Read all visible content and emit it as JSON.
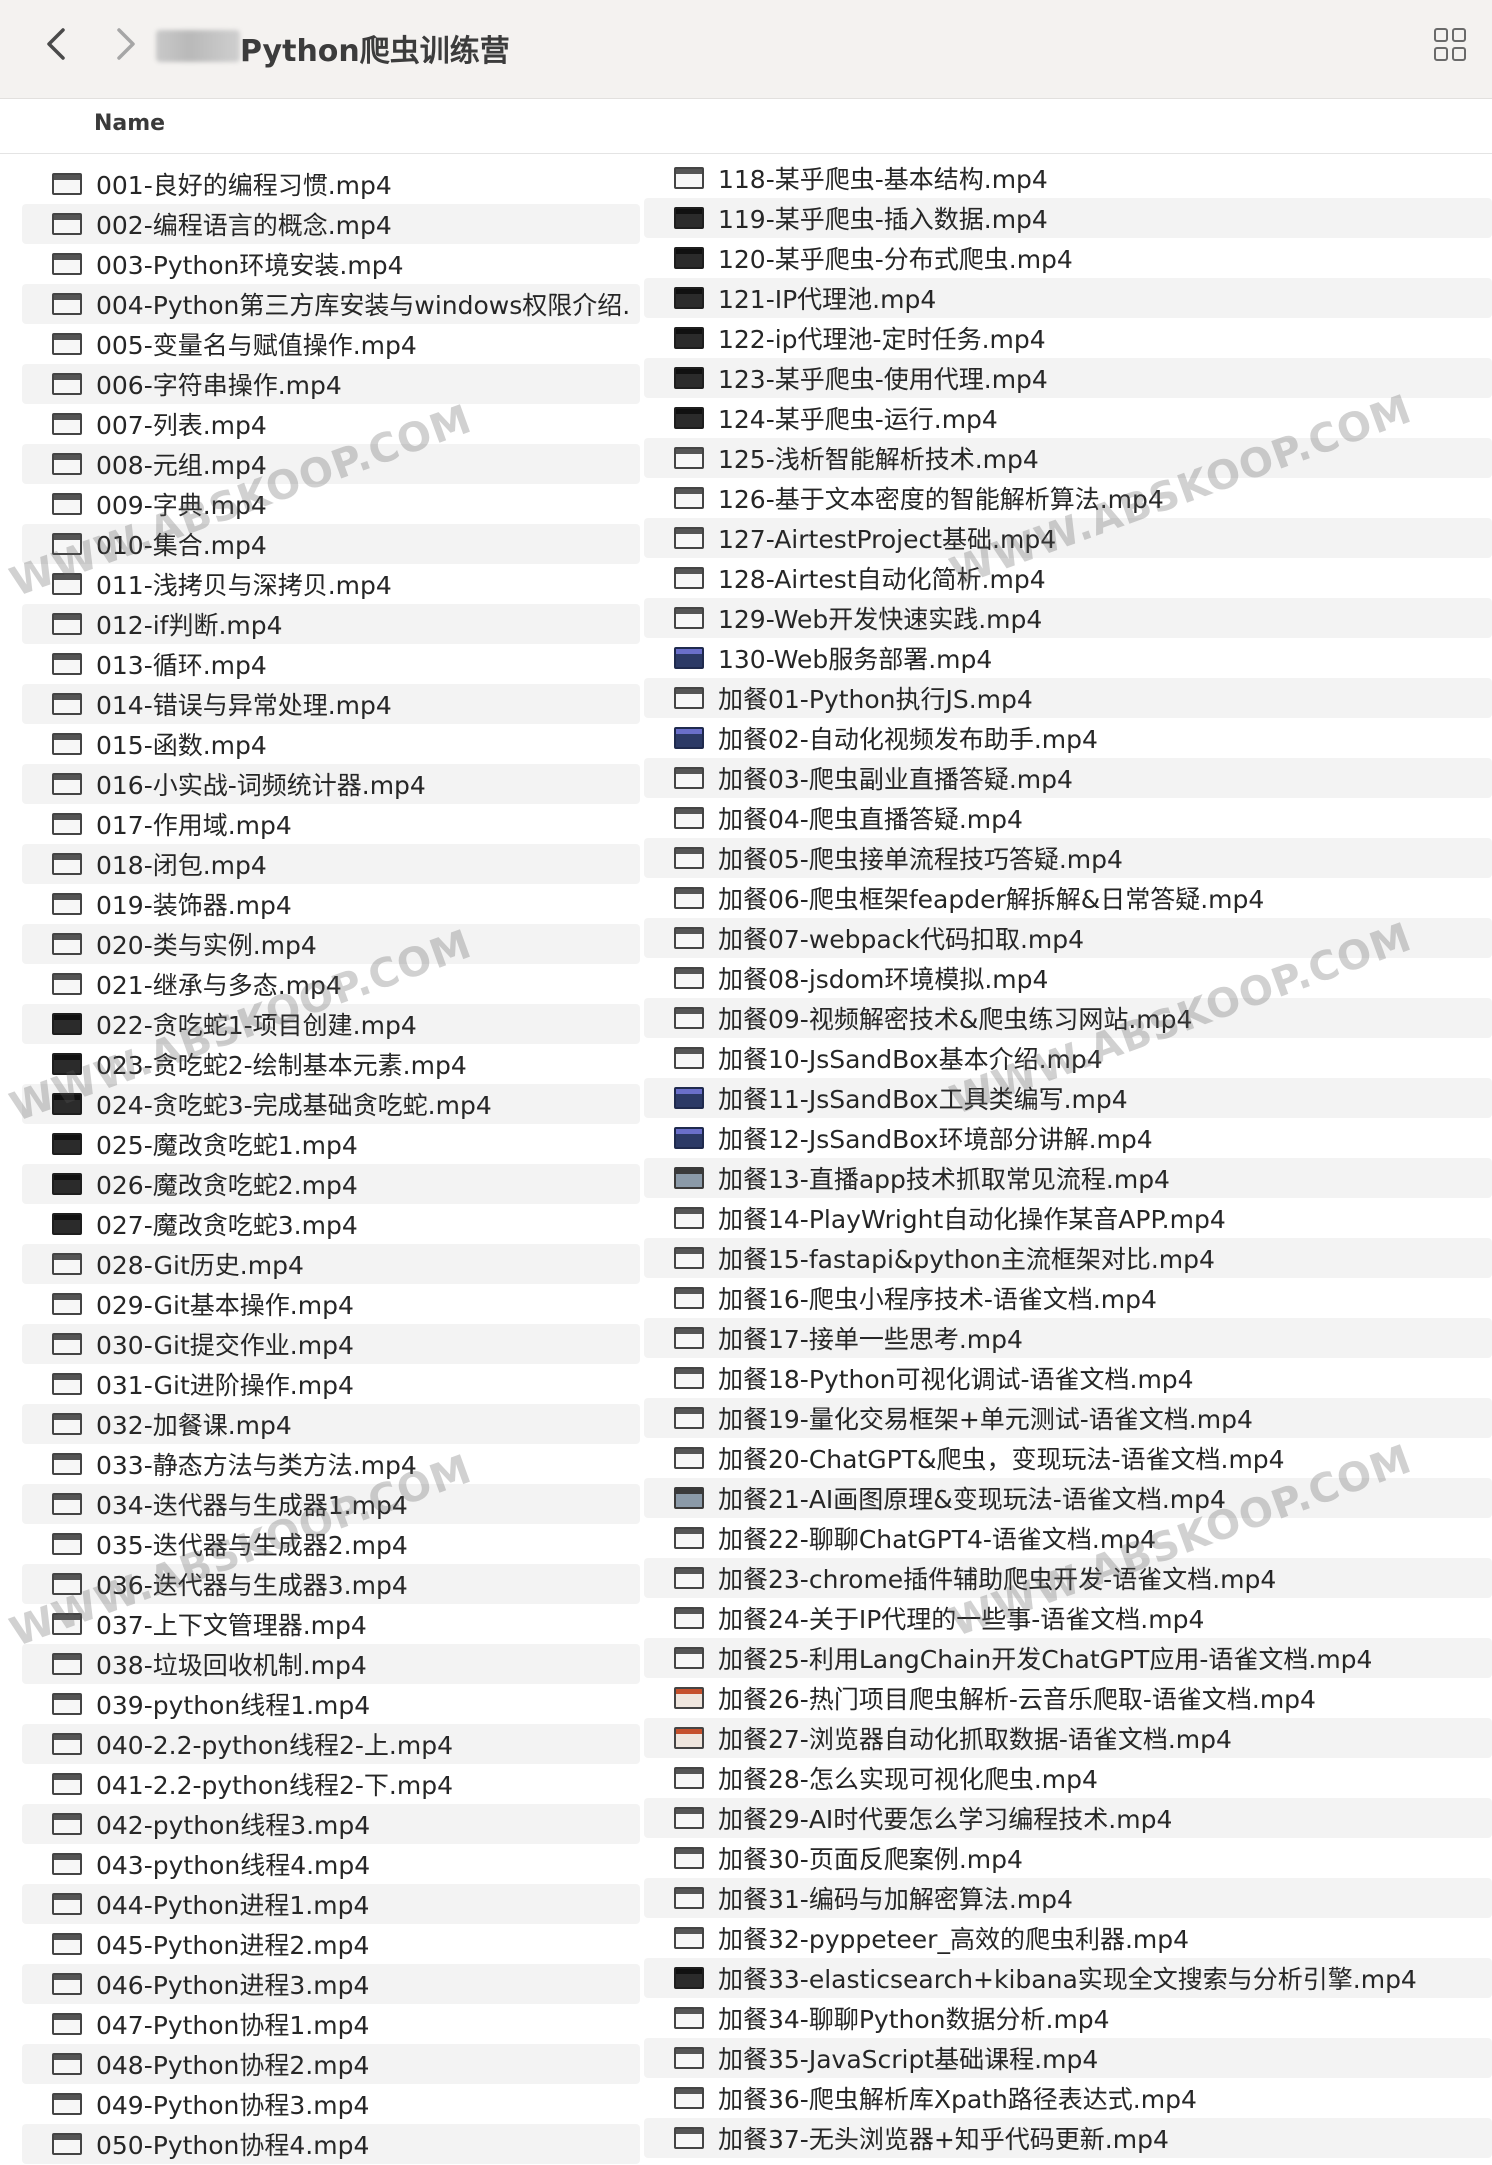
{
  "toolbar": {
    "back_icon": "chevron-left-icon",
    "forward_icon": "chevron-right-icon",
    "title": "Python爬虫训练营",
    "view_icon": "grid-view-icon"
  },
  "header": {
    "name_column": "Name"
  },
  "watermark_text": "WWW.ABSKOOP.COM",
  "left_files": [
    "001-良好的编程习惯.mp4",
    "002-编程语言的概念.mp4",
    "003-Python环境安装.mp4",
    "004-Python第三方库安装与windows权限介绍.",
    "005-变量名与赋值操作.mp4",
    "006-字符串操作.mp4",
    "007-列表.mp4",
    "008-元组.mp4",
    "009-字典.mp4",
    "010-集合.mp4",
    "011-浅拷贝与深拷贝.mp4",
    "012-if判断.mp4",
    "013-循环.mp4",
    "014-错误与异常处理.mp4",
    "015-函数.mp4",
    "016-小实战-词频统计器.mp4",
    "017-作用域.mp4",
    "018-闭包.mp4",
    "019-装饰器.mp4",
    "020-类与实例.mp4",
    "021-继承与多态.mp4",
    "022-贪吃蛇1-项目创建.mp4",
    "023-贪吃蛇2-绘制基本元素.mp4",
    "024-贪吃蛇3-完成基础贪吃蛇.mp4",
    "025-魔改贪吃蛇1.mp4",
    "026-魔改贪吃蛇2.mp4",
    "027-魔改贪吃蛇3.mp4",
    "028-Git历史.mp4",
    "029-Git基本操作.mp4",
    "030-Git提交作业.mp4",
    "031-Git进阶操作.mp4",
    "032-加餐课.mp4",
    "033-静态方法与类方法.mp4",
    "034-迭代器与生成器1.mp4",
    "035-迭代器与生成器2.mp4",
    "036-迭代器与生成器3.mp4",
    "037-上下文管理器.mp4",
    "038-垃圾回收机制.mp4",
    "039-python线程1.mp4",
    "040-2.2-python线程2-上.mp4",
    "041-2.2-python线程2-下.mp4",
    "042-python线程3.mp4",
    "043-python线程4.mp4",
    "044-Python进程1.mp4",
    "045-Python进程2.mp4",
    "046-Python进程3.mp4",
    "047-Python协程1.mp4",
    "048-Python协程2.mp4",
    "049-Python协程3.mp4",
    "050-Python协程4.mp4"
  ],
  "right_files": [
    "118-某乎爬虫-基本结构.mp4",
    "119-某乎爬虫-插入数据.mp4",
    "120-某乎爬虫-分布式爬虫.mp4",
    "121-IP代理池.mp4",
    "122-ip代理池-定时任务.mp4",
    "123-某乎爬虫-使用代理.mp4",
    "124-某乎爬虫-运行.mp4",
    "125-浅析智能解析技术.mp4",
    "126-基于文本密度的智能解析算法.mp4",
    "127-AirtestProject基础.mp4",
    "128-Airtest自动化简析.mp4",
    "129-Web开发快速实践.mp4",
    "130-Web服务部署.mp4",
    "加餐01-Python执行JS.mp4",
    "加餐02-自动化视频发布助手.mp4",
    "加餐03-爬虫副业直播答疑.mp4",
    "加餐04-爬虫直播答疑.mp4",
    "加餐05-爬虫接单流程技巧答疑.mp4",
    "加餐06-爬虫框架feapder解拆解&日常答疑.mp4",
    "加餐07-webpack代码扣取.mp4",
    "加餐08-jsdom环境模拟.mp4",
    "加餐09-视频解密技术&爬虫练习网站.mp4",
    "加餐10-JsSandBox基本介绍.mp4",
    "加餐11-JsSandBox工具类编写.mp4",
    "加餐12-JsSandBox环境部分讲解.mp4",
    "加餐13-直播app技术抓取常见流程.mp4",
    "加餐14-PlayWright自动化操作某音APP.mp4",
    "加餐15-fastapi&python主流框架对比.mp4",
    "加餐16-爬虫小程序技术-语雀文档.mp4",
    "加餐17-接单一些思考.mp4",
    "加餐18-Python可视化调试-语雀文档.mp4",
    "加餐19-量化交易框架+单元测试-语雀文档.mp4",
    "加餐20-ChatGPT&爬虫，变现玩法-语雀文档.mp4",
    "加餐21-AI画图原理&变现玩法-语雀文档.mp4",
    "加餐22-聊聊ChatGPT4-语雀文档.mp4",
    "加餐23-chrome插件辅助爬虫开发-语雀文档.mp4",
    "加餐24-关于IP代理的一些事-语雀文档.mp4",
    "加餐25-利用LangChain开发ChatGPT应用-语雀文档.mp4",
    "加餐26-热门项目爬虫解析-云音乐爬取-语雀文档.mp4",
    "加餐27-浏览器自动化抓取数据-语雀文档.mp4",
    "加餐28-怎么实现可视化爬虫.mp4",
    "加餐29-AI时代要怎么学习编程技术.mp4",
    "加餐30-页面反爬案例.mp4",
    "加餐31-编码与加解密算法.mp4",
    "加餐32-pyppeteer_高效的爬虫利器.mp4",
    "加餐33-elasticsearch+kibana实现全文搜索与分析引擎.mp4",
    "加餐34-聊聊Python数据分析.mp4",
    "加餐35-JavaScript基础课程.mp4",
    "加餐36-爬虫解析库Xpath路径表达式.mp4",
    "加餐37-无头浏览器+知乎代码更新.mp4"
  ]
}
